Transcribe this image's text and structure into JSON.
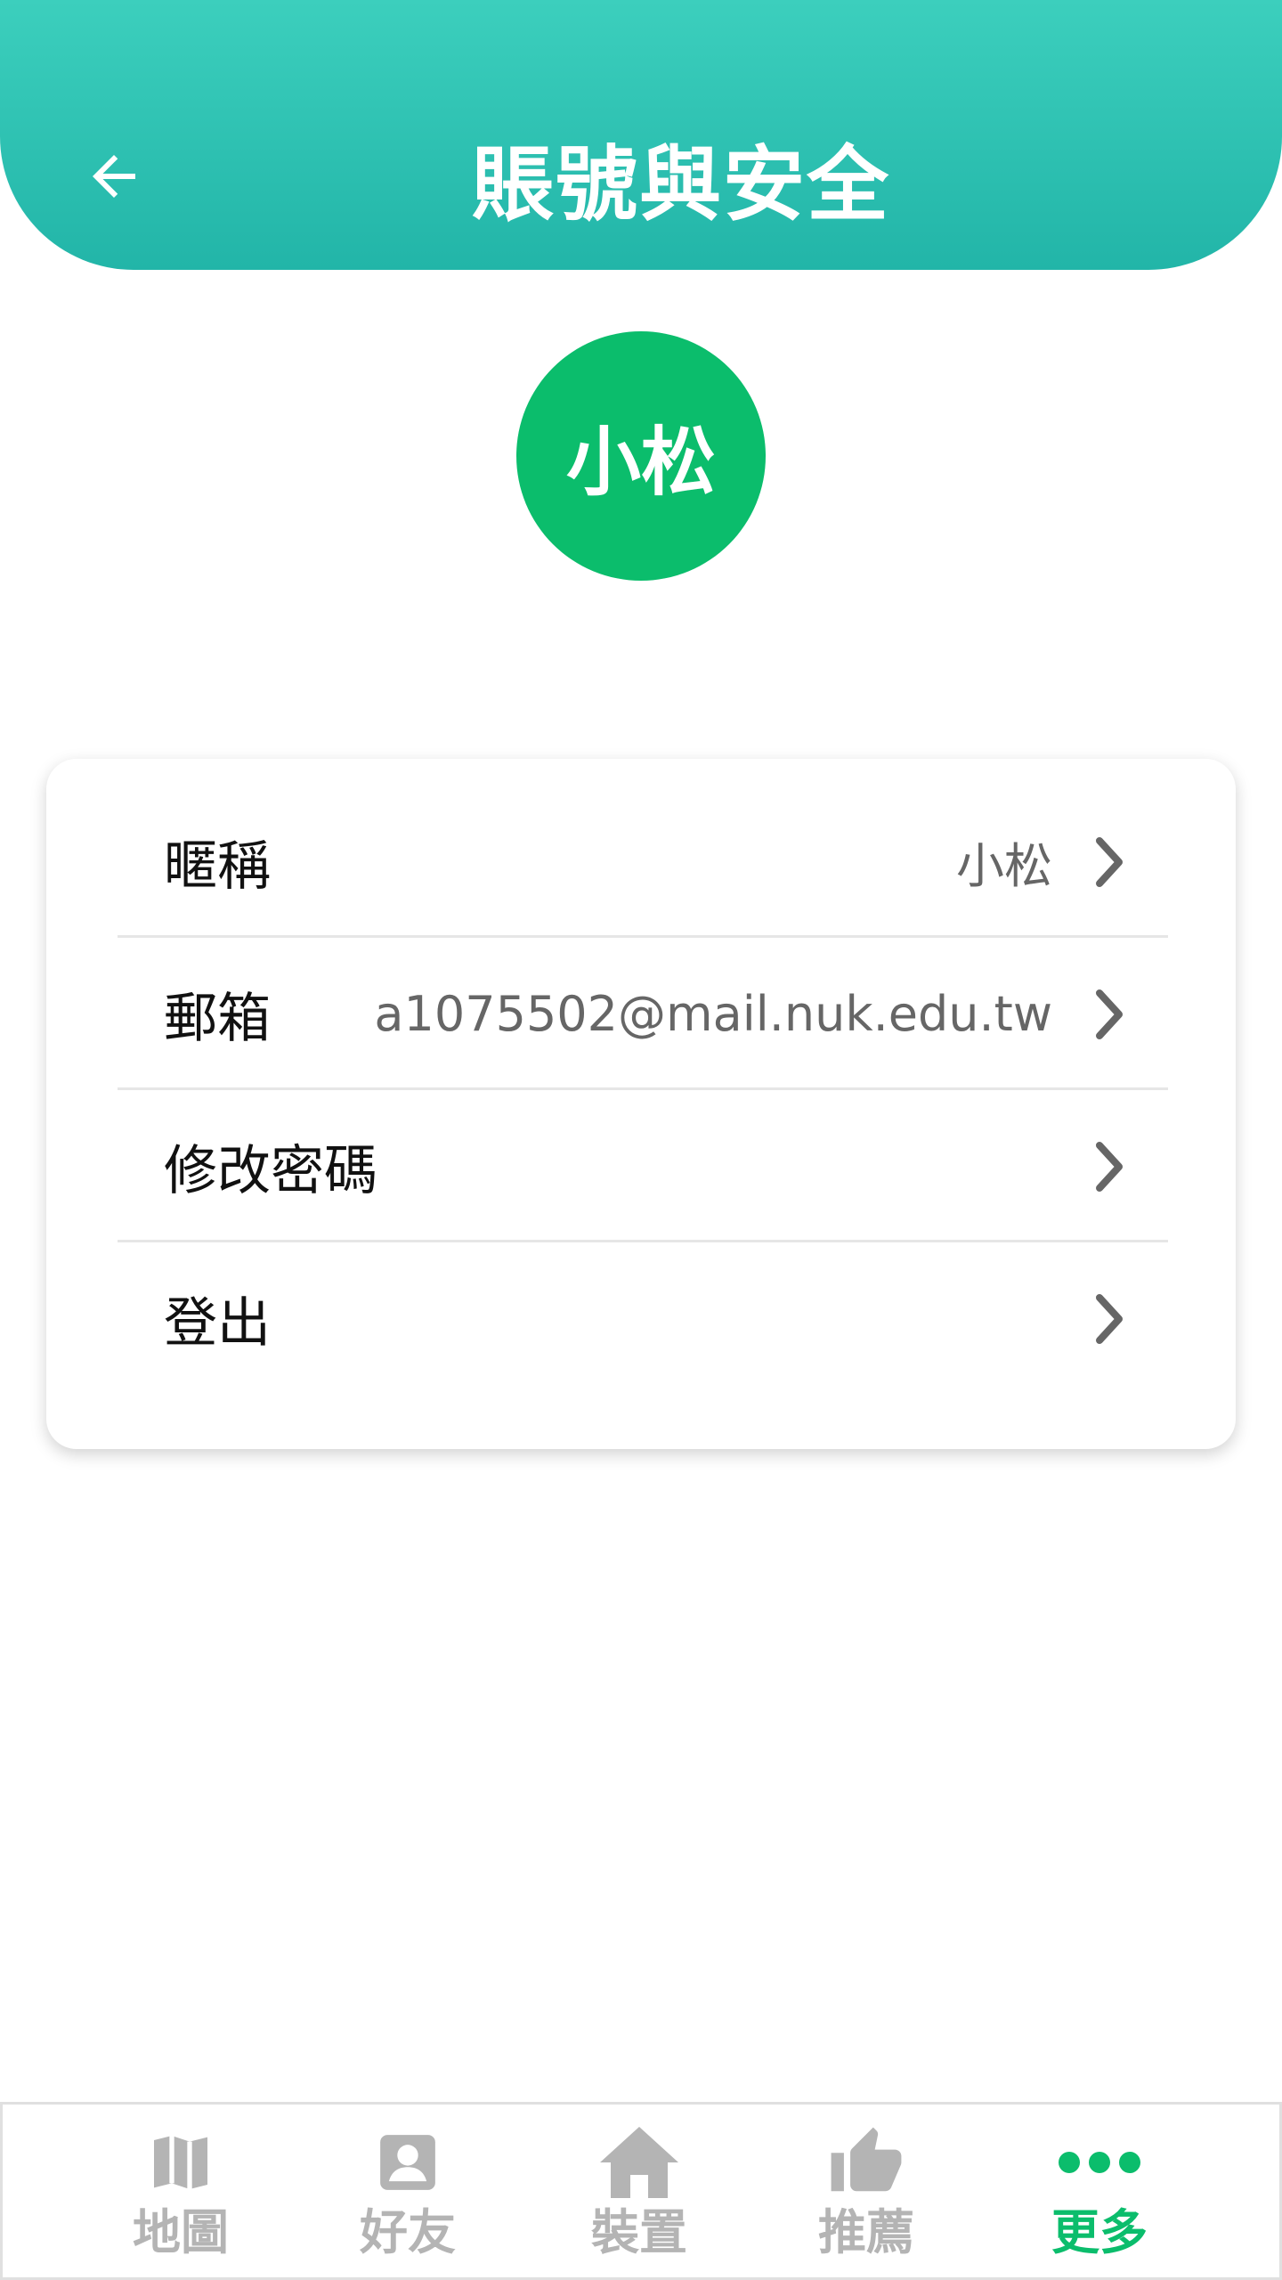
{
  "header": {
    "title": "賬號與安全",
    "back_icon": "arrow-left-icon"
  },
  "avatar": {
    "text": "小松",
    "color": "#0bbd6c"
  },
  "settings": {
    "items": [
      {
        "label": "暱稱",
        "value": "小松"
      },
      {
        "label": "郵箱",
        "value": "a1075502@mail.nuk.edu.tw"
      },
      {
        "label": "修改密碼",
        "value": ""
      },
      {
        "label": "登出",
        "value": ""
      }
    ]
  },
  "tabbar": {
    "active_color": "#0bbd6c",
    "inactive_color": "#b4b4b4",
    "tabs": [
      {
        "label": "地圖",
        "icon": "map-icon"
      },
      {
        "label": "好友",
        "icon": "contact-icon"
      },
      {
        "label": "裝置",
        "icon": "home-icon"
      },
      {
        "label": "推薦",
        "icon": "thumbs-up-icon"
      },
      {
        "label": "更多",
        "icon": "more-dots-icon"
      }
    ]
  }
}
